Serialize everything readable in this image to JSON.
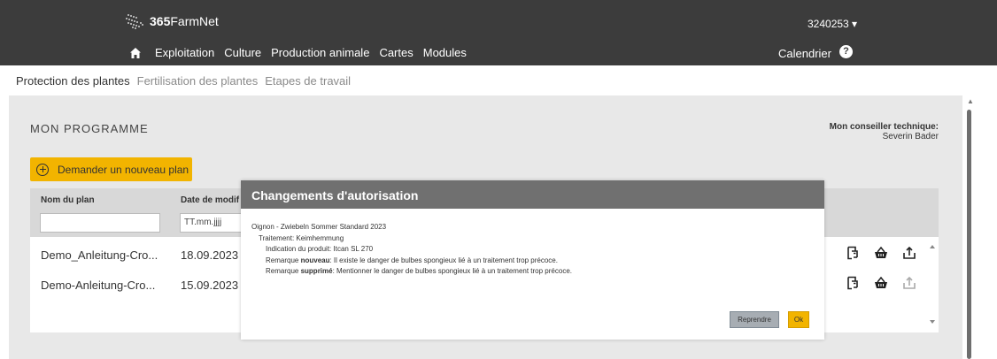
{
  "header": {
    "brand_bold": "365",
    "brand_rest": "FarmNet",
    "account": "3240253 ▾",
    "nav": [
      "Exploitation",
      "Culture",
      "Production animale",
      "Cartes",
      "Modules"
    ],
    "calendar": "Calendrier",
    "help": "?"
  },
  "subtabs": [
    "Protection des plantes",
    "Fertilisation des plantes",
    "Etapes de travail"
  ],
  "main": {
    "title": "MON PROGRAMME",
    "advisor_label": "Mon conseiller technique:",
    "advisor_name": "Severin Bader",
    "new_plan_label": "Demander un nouveau plan"
  },
  "table": {
    "columns": [
      "Nom du plan",
      "Date de modif"
    ],
    "date_filter_placeholder": "TT.mm.jjjj",
    "rows": [
      {
        "name": "Demo_Anleitung-Cro...",
        "date": "18.09.2023"
      },
      {
        "name": "Demo-Anleitung-Cro...",
        "date": "15.09.2023"
      }
    ]
  },
  "modal": {
    "title": "Changements d'autorisation",
    "line1": "Oignon - Zwiebeln Sommer Standard 2023",
    "line2": "Traitement: Keimhemmung",
    "line3": "Indication du produit: Itcan SL 270",
    "note_new_prefix": "Remarque ",
    "note_new_keyword": "nouveau",
    "note_new_text": ": Il existe le danger de bulbes spongieux lié à un traitement trop précoce.",
    "note_del_prefix": "Remarque ",
    "note_del_keyword": "supprimé",
    "note_del_text": ": Mentionner le danger de bulbes spongieux lié à un traitement trop précoce.",
    "btn_reprendre": "Reprendre",
    "btn_ok": "Ok"
  },
  "colors": {
    "header_bg": "#3c3c3c",
    "accent": "#f2b400",
    "modal_header": "#707070",
    "panel_bg": "#e8e8e8"
  }
}
